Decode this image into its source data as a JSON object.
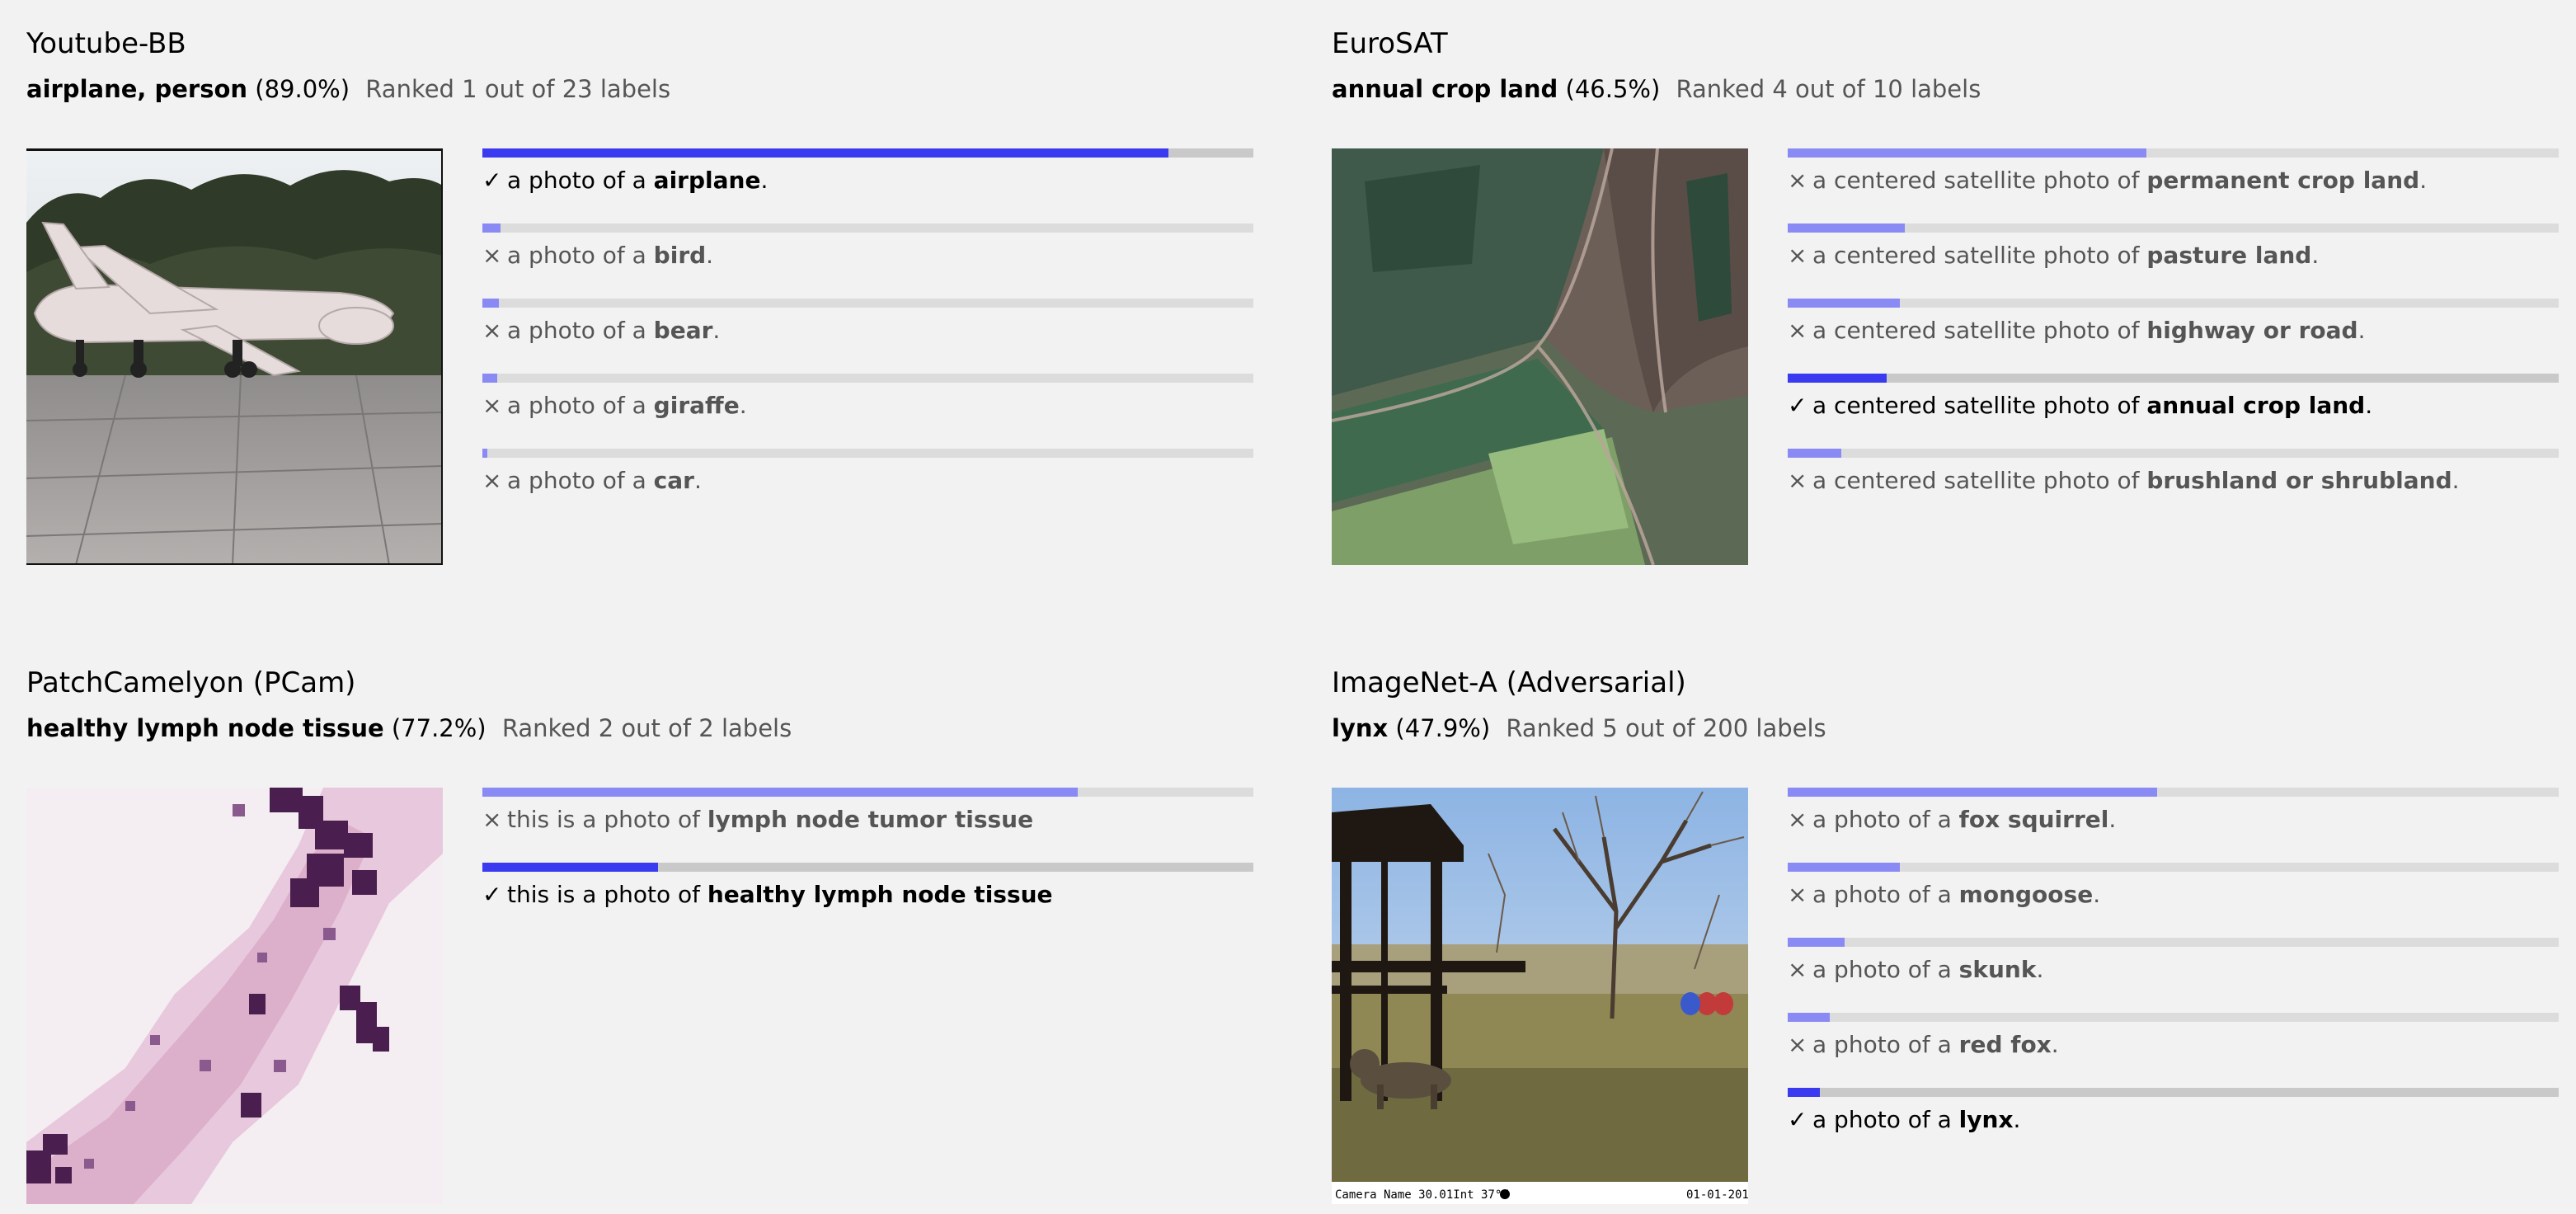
{
  "panels": [
    {
      "title": "Youtube-BB",
      "answer": "airplane, person",
      "percent": "(89.0%)",
      "rank_text": "Ranked 1 out of 23 labels",
      "image_icon": "airplane-photo",
      "predictions": [
        {
          "mark": "✓",
          "prefix": "a photo of a ",
          "label": "airplane",
          "suffix": ".",
          "correct": true,
          "score": 0.89
        },
        {
          "mark": "×",
          "prefix": "a photo of a ",
          "label": "bird",
          "suffix": ".",
          "correct": false,
          "score": 0.023
        },
        {
          "mark": "×",
          "prefix": "a photo of a ",
          "label": "bear",
          "suffix": ".",
          "correct": false,
          "score": 0.021
        },
        {
          "mark": "×",
          "prefix": "a photo of a ",
          "label": "giraffe",
          "suffix": ".",
          "correct": false,
          "score": 0.019
        },
        {
          "mark": "×",
          "prefix": "a photo of a ",
          "label": "car",
          "suffix": ".",
          "correct": false,
          "score": 0.006
        }
      ]
    },
    {
      "title": "EuroSAT",
      "answer": "annual crop land",
      "percent": "(46.5%)",
      "rank_text": "Ranked 4 out of 10 labels",
      "image_icon": "satellite-photo",
      "predictions": [
        {
          "mark": "×",
          "prefix": "a centered satellite photo of ",
          "label": "permanent crop land",
          "suffix": ".",
          "correct": false,
          "score": 0.465
        },
        {
          "mark": "×",
          "prefix": "a centered satellite photo of ",
          "label": "pasture land",
          "suffix": ".",
          "correct": false,
          "score": 0.152
        },
        {
          "mark": "×",
          "prefix": "a centered satellite photo of ",
          "label": "highway or road",
          "suffix": ".",
          "correct": false,
          "score": 0.145
        },
        {
          "mark": "✓",
          "prefix": "a centered satellite photo of ",
          "label": "annual crop land",
          "suffix": ".",
          "correct": true,
          "score": 0.128
        },
        {
          "mark": "×",
          "prefix": "a centered satellite photo of ",
          "label": "brushland or shrubland",
          "suffix": ".",
          "correct": false,
          "score": 0.07
        }
      ]
    },
    {
      "title": "PatchCamelyon (PCam)",
      "answer": "healthy lymph node tissue",
      "percent": "(77.2%)",
      "rank_text": "Ranked 2 out of 2 labels",
      "image_icon": "tissue-photo",
      "predictions": [
        {
          "mark": "×",
          "prefix": "this is a photo of ",
          "label": "lymph node tumor tissue",
          "suffix": "",
          "correct": false,
          "score": 0.772
        },
        {
          "mark": "✓",
          "prefix": "this is a photo of ",
          "label": "healthy lymph node tissue",
          "suffix": "",
          "correct": true,
          "score": 0.228
        }
      ]
    },
    {
      "title": "ImageNet-A (Adversarial)",
      "answer": "lynx",
      "percent": "(47.9%)",
      "rank_text": "Ranked 5 out of 200 labels",
      "image_icon": "lynx-photo",
      "image_caption_left": "Camera Name 30.01Int 37°F",
      "image_caption_right": "01-01-201",
      "predictions": [
        {
          "mark": "×",
          "prefix": "a photo of a ",
          "label": "fox squirrel",
          "suffix": ".",
          "correct": false,
          "score": 0.479
        },
        {
          "mark": "×",
          "prefix": "a photo of a ",
          "label": "mongoose",
          "suffix": ".",
          "correct": false,
          "score": 0.145
        },
        {
          "mark": "×",
          "prefix": "a photo of a ",
          "label": "skunk",
          "suffix": ".",
          "correct": false,
          "score": 0.074
        },
        {
          "mark": "×",
          "prefix": "a photo of a ",
          "label": "red fox",
          "suffix": ".",
          "correct": false,
          "score": 0.055
        },
        {
          "mark": "✓",
          "prefix": "a photo of a ",
          "label": "lynx",
          "suffix": ".",
          "correct": true,
          "score": 0.042
        }
      ]
    }
  ]
}
